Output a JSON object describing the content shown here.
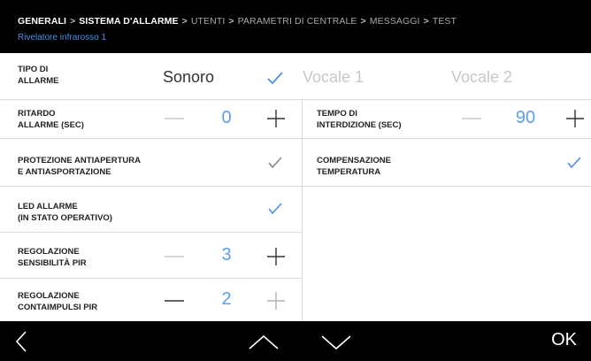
{
  "breadcrumb": {
    "items": [
      {
        "label": "GENERALI",
        "active": true
      },
      {
        "label": "SISTEMA D'ALLARME",
        "active": true
      },
      {
        "label": "UTENTI",
        "active": false
      },
      {
        "label": "PARAMETRI DI CENTRALE",
        "active": false
      },
      {
        "label": "MESSAGGI",
        "active": false
      },
      {
        "label": "TEST",
        "active": false
      }
    ],
    "separator": ">"
  },
  "subtitle": "Rivelatore infrarosso 1",
  "rows": {
    "tipo_allarme": {
      "label_line1": "TIPO DI",
      "label_line2": "ALLARME",
      "options": [
        {
          "label": "Sonoro",
          "selected": true
        },
        {
          "label": "Vocale 1",
          "selected": false
        },
        {
          "label": "Vocale 2",
          "selected": false
        }
      ]
    },
    "ritardo_allarme": {
      "label_line1": "RITARDO",
      "label_line2": "ALLARME (SEC)",
      "value": "0"
    },
    "tempo_interdizione": {
      "label_line1": "TEMPO DI",
      "label_line2": "INTERDIZIONE (SEC)",
      "value": "90"
    },
    "protezione": {
      "label_line1": "PROTEZIONE ANTIAPERTURA",
      "label_line2": "E ANTIASPORTAZIONE",
      "checked": true
    },
    "compensazione": {
      "label_line1": "COMPENSAZIONE",
      "label_line2": "TEMPERATURA",
      "checked": true
    },
    "led_allarme": {
      "label_line1": "LED ALLARME",
      "label_line2": "(IN STATO OPERATIVO)",
      "checked": true
    },
    "sensibilita": {
      "label_line1": "REGOLAZIONE",
      "label_line2": "SENSIBILITÀ PIR",
      "value": "3"
    },
    "contaimpulsi": {
      "label_line1": "REGOLAZIONE",
      "label_line2": "CONTAIMPULSI PIR",
      "value": "2"
    }
  },
  "footer": {
    "back_icon": "chevron-left-icon",
    "up_icon": "chevron-up-icon",
    "down_icon": "chevron-down-icon",
    "ok_label": "OK"
  },
  "colors": {
    "accent": "#4d8fe6",
    "value_blue": "#5aa0ea",
    "check_gray": "#8a8a8a",
    "disabled_gray": "#c8c8c8",
    "header_bg": "#000000"
  }
}
